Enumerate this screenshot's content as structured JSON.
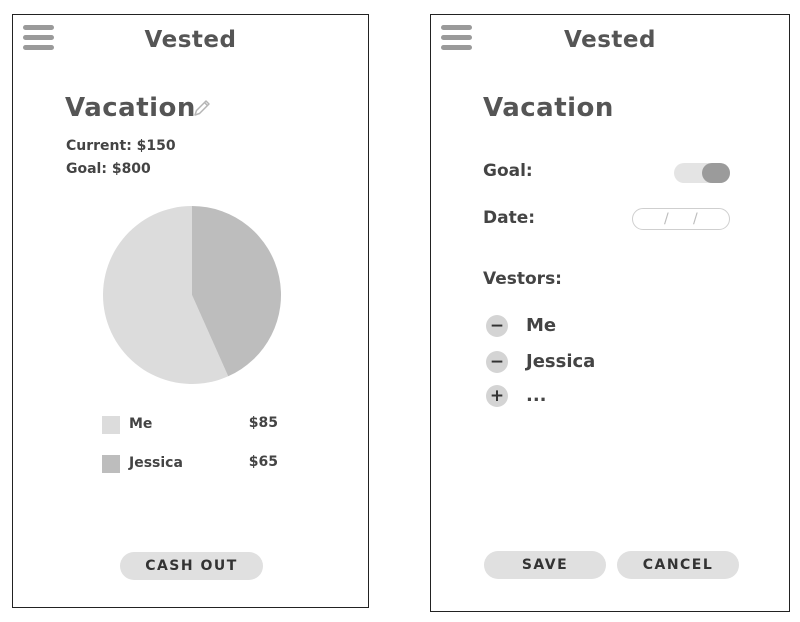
{
  "left_screen": {
    "app_title": "Vested",
    "page_title": "Vacation",
    "current": "Current: $150",
    "goal": "Goal: $800",
    "legend": [
      {
        "name": "Me",
        "amount": "$85",
        "color": "#dcdcdc"
      },
      {
        "name": "Jessica",
        "amount": "$65",
        "color": "#bdbdbd"
      }
    ],
    "cashout_label": "CASH OUT"
  },
  "chart_data": {
    "type": "pie",
    "categories": [
      "Me",
      "Jessica"
    ],
    "values": [
      85,
      65
    ],
    "colors": [
      "#dcdcdc",
      "#bdbdbd"
    ]
  },
  "right_screen": {
    "app_title": "Vested",
    "page_title": "Vacation",
    "goal_label": "Goal:",
    "goal_toggle_on": true,
    "date_label": "Date:",
    "date_separators": [
      "/",
      "/"
    ],
    "vestors_label": "Vestors:",
    "vestors": [
      {
        "name": "Me",
        "action": "−"
      },
      {
        "name": "Jessica",
        "action": "−"
      }
    ],
    "add_vestor": {
      "label": "...",
      "action": "+"
    },
    "save_label": "SAVE",
    "cancel_label": "CANCEL"
  },
  "icons": {
    "menu": "hamburger-menu-icon",
    "edit": "pencil-icon",
    "remove": "minus-circle-icon",
    "add": "plus-circle-icon"
  }
}
